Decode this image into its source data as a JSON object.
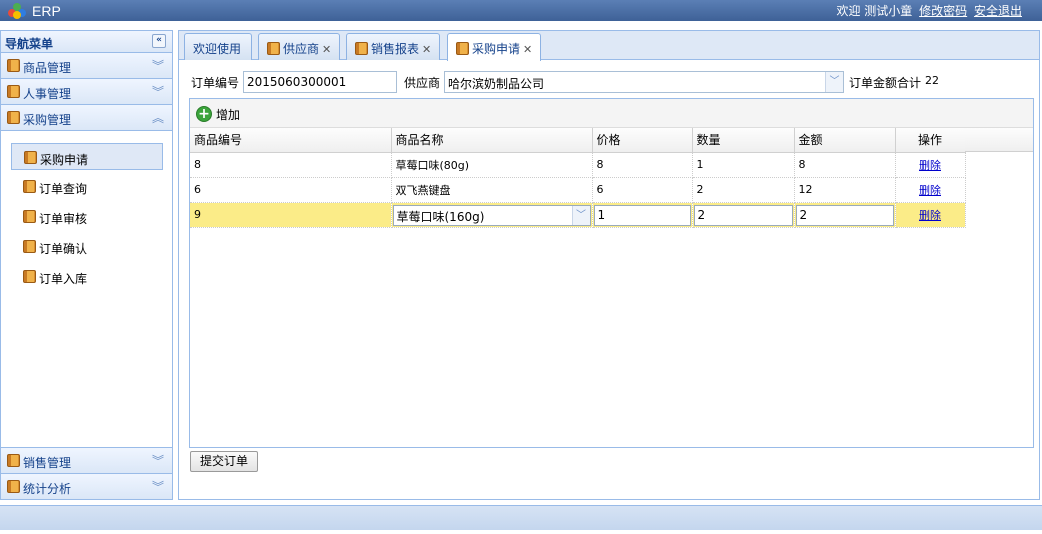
{
  "app": {
    "title": "ERP"
  },
  "user_area": {
    "welcome": "欢迎 测试小童",
    "change_password": "修改密码",
    "logout": "安全退出"
  },
  "sidebar": {
    "title": "导航菜单",
    "sections": [
      {
        "label": "商品管理"
      },
      {
        "label": "人事管理"
      },
      {
        "label": "采购管理",
        "expanded": true
      }
    ],
    "sub_items": [
      {
        "label": "采购申请",
        "active": true
      },
      {
        "label": "订单查询"
      },
      {
        "label": "订单审核"
      },
      {
        "label": "订单确认"
      },
      {
        "label": "订单入库"
      }
    ],
    "bottom_sections": [
      {
        "label": "销售管理"
      },
      {
        "label": "统计分析"
      }
    ]
  },
  "tabs": [
    {
      "label": "欢迎使用",
      "closable": false
    },
    {
      "label": "供应商",
      "closable": true
    },
    {
      "label": "销售报表",
      "closable": true
    },
    {
      "label": "采购申请",
      "closable": true,
      "active": true
    }
  ],
  "form": {
    "order_no_label": "订单编号",
    "order_no_value": "2015060300001",
    "supplier_label": "供应商",
    "supplier_value": "哈尔滨奶制品公司",
    "total_label": "订单金额合计",
    "total_value": "22"
  },
  "grid": {
    "toolbar_add": "增加",
    "columns": [
      "商品编号",
      "商品名称",
      "价格",
      "数量",
      "金额",
      "操作"
    ],
    "rows": [
      {
        "id": "8",
        "name": "草莓口味(80g)",
        "price": "8",
        "qty": "1",
        "amount": "8",
        "op": "删除"
      },
      {
        "id": "6",
        "name": "双飞燕键盘",
        "price": "6",
        "qty": "2",
        "amount": "12",
        "op": "删除"
      },
      {
        "id": "9",
        "name": "草莓口味(160g)",
        "price": "1",
        "qty": "2",
        "amount": "2",
        "op": "删除",
        "editing": true
      }
    ]
  },
  "actions": {
    "submit": "提交订单"
  },
  "colors": {
    "header_blue": "#3e6197",
    "panel_border": "#99bbe8",
    "edit_row": "#fbec88",
    "link": "#0000cc"
  }
}
